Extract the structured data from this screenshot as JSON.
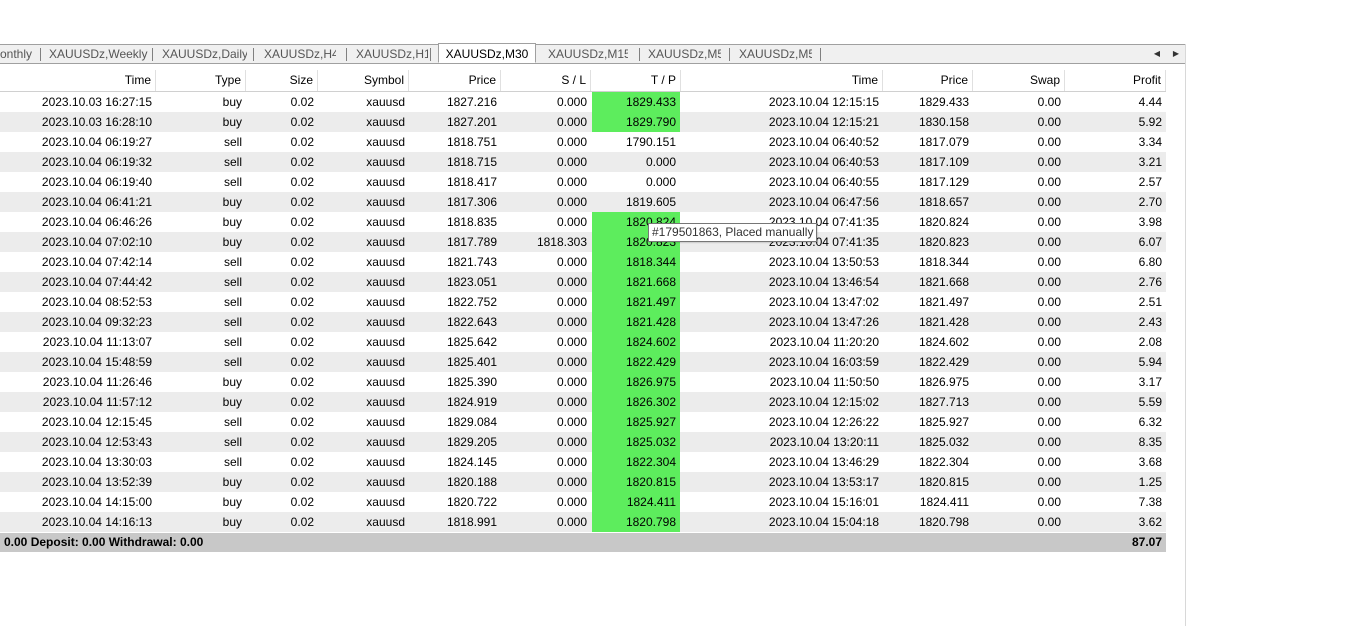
{
  "tabs": [
    "onthly",
    "XAUUSDz,Weekly",
    "XAUUSDz,Daily",
    "XAUUSDz,H4",
    "XAUUSDz,H1",
    "XAUUSDz,M30",
    "XAUUSDz,M15",
    "XAUUSDz,M5",
    "XAUUSDz,M5"
  ],
  "active_tab": "XAUUSDz,M30",
  "tab_scroll": {
    "left_icon": "chevron-left-icon",
    "right_icon": "chevron-right-icon"
  },
  "columns": [
    "Time",
    "Type",
    "Size",
    "Symbol",
    "Price",
    "S / L",
    "T / P",
    "Time",
    "Price",
    "Swap",
    "Profit"
  ],
  "colors": {
    "tp_highlight": "#5ded5d",
    "row_alt": "#ececec",
    "summary_bg": "#c8c8c8"
  },
  "rows": [
    {
      "open_time": "2023.10.03 16:27:15",
      "type": "buy",
      "size": "0.02",
      "symbol": "xauusd",
      "price": "1827.216",
      "sl": "0.000",
      "tp": "1829.433",
      "close_time": "2023.10.04 12:15:15",
      "close_price": "1829.433",
      "swap": "0.00",
      "profit": "4.44",
      "tp_hit": true
    },
    {
      "open_time": "2023.10.03 16:28:10",
      "type": "buy",
      "size": "0.02",
      "symbol": "xauusd",
      "price": "1827.201",
      "sl": "0.000",
      "tp": "1829.790",
      "close_time": "2023.10.04 12:15:21",
      "close_price": "1830.158",
      "swap": "0.00",
      "profit": "5.92",
      "tp_hit": true
    },
    {
      "open_time": "2023.10.04 06:19:27",
      "type": "sell",
      "size": "0.02",
      "symbol": "xauusd",
      "price": "1818.751",
      "sl": "0.000",
      "tp": "1790.151",
      "close_time": "2023.10.04 06:40:52",
      "close_price": "1817.079",
      "swap": "0.00",
      "profit": "3.34",
      "tp_hit": false
    },
    {
      "open_time": "2023.10.04 06:19:32",
      "type": "sell",
      "size": "0.02",
      "symbol": "xauusd",
      "price": "1818.715",
      "sl": "0.000",
      "tp": "0.000",
      "close_time": "2023.10.04 06:40:53",
      "close_price": "1817.109",
      "swap": "0.00",
      "profit": "3.21",
      "tp_hit": false
    },
    {
      "open_time": "2023.10.04 06:19:40",
      "type": "sell",
      "size": "0.02",
      "symbol": "xauusd",
      "price": "1818.417",
      "sl": "0.000",
      "tp": "0.000",
      "close_time": "2023.10.04 06:40:55",
      "close_price": "1817.129",
      "swap": "0.00",
      "profit": "2.57",
      "tp_hit": false
    },
    {
      "open_time": "2023.10.04 06:41:21",
      "type": "buy",
      "size": "0.02",
      "symbol": "xauusd",
      "price": "1817.306",
      "sl": "0.000",
      "tp": "1819.605",
      "close_time": "2023.10.04 06:47:56",
      "close_price": "1818.657",
      "swap": "0.00",
      "profit": "2.70",
      "tp_hit": false
    },
    {
      "open_time": "2023.10.04 06:46:26",
      "type": "buy",
      "size": "0.02",
      "symbol": "xauusd",
      "price": "1818.835",
      "sl": "0.000",
      "tp": "1820.824",
      "close_time": "2023.10.04 07:41:35",
      "close_price": "1820.824",
      "swap": "0.00",
      "profit": "3.98",
      "tp_hit": true
    },
    {
      "open_time": "2023.10.04 07:02:10",
      "type": "buy",
      "size": "0.02",
      "symbol": "xauusd",
      "price": "1817.789",
      "sl": "1818.303",
      "tp": "1820.823",
      "close_time": "2023.10.04 07:41:35",
      "close_price": "1820.823",
      "swap": "0.00",
      "profit": "6.07",
      "tp_hit": true
    },
    {
      "open_time": "2023.10.04 07:42:14",
      "type": "sell",
      "size": "0.02",
      "symbol": "xauusd",
      "price": "1821.743",
      "sl": "0.000",
      "tp": "1818.344",
      "close_time": "2023.10.04 13:50:53",
      "close_price": "1818.344",
      "swap": "0.00",
      "profit": "6.80",
      "tp_hit": true
    },
    {
      "open_time": "2023.10.04 07:44:42",
      "type": "sell",
      "size": "0.02",
      "symbol": "xauusd",
      "price": "1823.051",
      "sl": "0.000",
      "tp": "1821.668",
      "close_time": "2023.10.04 13:46:54",
      "close_price": "1821.668",
      "swap": "0.00",
      "profit": "2.76",
      "tp_hit": true
    },
    {
      "open_time": "2023.10.04 08:52:53",
      "type": "sell",
      "size": "0.02",
      "symbol": "xauusd",
      "price": "1822.752",
      "sl": "0.000",
      "tp": "1821.497",
      "close_time": "2023.10.04 13:47:02",
      "close_price": "1821.497",
      "swap": "0.00",
      "profit": "2.51",
      "tp_hit": true
    },
    {
      "open_time": "2023.10.04 09:32:23",
      "type": "sell",
      "size": "0.02",
      "symbol": "xauusd",
      "price": "1822.643",
      "sl": "0.000",
      "tp": "1821.428",
      "close_time": "2023.10.04 13:47:26",
      "close_price": "1821.428",
      "swap": "0.00",
      "profit": "2.43",
      "tp_hit": true
    },
    {
      "open_time": "2023.10.04 11:13:07",
      "type": "sell",
      "size": "0.02",
      "symbol": "xauusd",
      "price": "1825.642",
      "sl": "0.000",
      "tp": "1824.602",
      "close_time": "2023.10.04 11:20:20",
      "close_price": "1824.602",
      "swap": "0.00",
      "profit": "2.08",
      "tp_hit": true
    },
    {
      "open_time": "2023.10.04 15:48:59",
      "type": "sell",
      "size": "0.02",
      "symbol": "xauusd",
      "price": "1825.401",
      "sl": "0.000",
      "tp": "1822.429",
      "close_time": "2023.10.04 16:03:59",
      "close_price": "1822.429",
      "swap": "0.00",
      "profit": "5.94",
      "tp_hit": true
    },
    {
      "open_time": "2023.10.04 11:26:46",
      "type": "buy",
      "size": "0.02",
      "symbol": "xauusd",
      "price": "1825.390",
      "sl": "0.000",
      "tp": "1826.975",
      "close_time": "2023.10.04 11:50:50",
      "close_price": "1826.975",
      "swap": "0.00",
      "profit": "3.17",
      "tp_hit": true
    },
    {
      "open_time": "2023.10.04 11:57:12",
      "type": "buy",
      "size": "0.02",
      "symbol": "xauusd",
      "price": "1824.919",
      "sl": "0.000",
      "tp": "1826.302",
      "close_time": "2023.10.04 12:15:02",
      "close_price": "1827.713",
      "swap": "0.00",
      "profit": "5.59",
      "tp_hit": true
    },
    {
      "open_time": "2023.10.04 12:15:45",
      "type": "sell",
      "size": "0.02",
      "symbol": "xauusd",
      "price": "1829.084",
      "sl": "0.000",
      "tp": "1825.927",
      "close_time": "2023.10.04 12:26:22",
      "close_price": "1825.927",
      "swap": "0.00",
      "profit": "6.32",
      "tp_hit": true
    },
    {
      "open_time": "2023.10.04 12:53:43",
      "type": "sell",
      "size": "0.02",
      "symbol": "xauusd",
      "price": "1829.205",
      "sl": "0.000",
      "tp": "1825.032",
      "close_time": "2023.10.04 13:20:11",
      "close_price": "1825.032",
      "swap": "0.00",
      "profit": "8.35",
      "tp_hit": true
    },
    {
      "open_time": "2023.10.04 13:30:03",
      "type": "sell",
      "size": "0.02",
      "symbol": "xauusd",
      "price": "1824.145",
      "sl": "0.000",
      "tp": "1822.304",
      "close_time": "2023.10.04 13:46:29",
      "close_price": "1822.304",
      "swap": "0.00",
      "profit": "3.68",
      "tp_hit": true
    },
    {
      "open_time": "2023.10.04 13:52:39",
      "type": "buy",
      "size": "0.02",
      "symbol": "xauusd",
      "price": "1820.188",
      "sl": "0.000",
      "tp": "1820.815",
      "close_time": "2023.10.04 13:53:17",
      "close_price": "1820.815",
      "swap": "0.00",
      "profit": "1.25",
      "tp_hit": true
    },
    {
      "open_time": "2023.10.04 14:15:00",
      "type": "buy",
      "size": "0.02",
      "symbol": "xauusd",
      "price": "1820.722",
      "sl": "0.000",
      "tp": "1824.411",
      "close_time": "2023.10.04 15:16:01",
      "close_price": "1824.411",
      "swap": "0.00",
      "profit": "7.38",
      "tp_hit": true
    },
    {
      "open_time": "2023.10.04 14:16:13",
      "type": "buy",
      "size": "0.02",
      "symbol": "xauusd",
      "price": "1818.991",
      "sl": "0.000",
      "tp": "1820.798",
      "close_time": "2023.10.04 15:04:18",
      "close_price": "1820.798",
      "swap": "0.00",
      "profit": "3.62",
      "tp_hit": true
    }
  ],
  "summary": {
    "text": "0.00  Deposit: 0.00  Withdrawal: 0.00",
    "total_profit": "87.07"
  },
  "tooltip": "#179501863, Placed manually"
}
